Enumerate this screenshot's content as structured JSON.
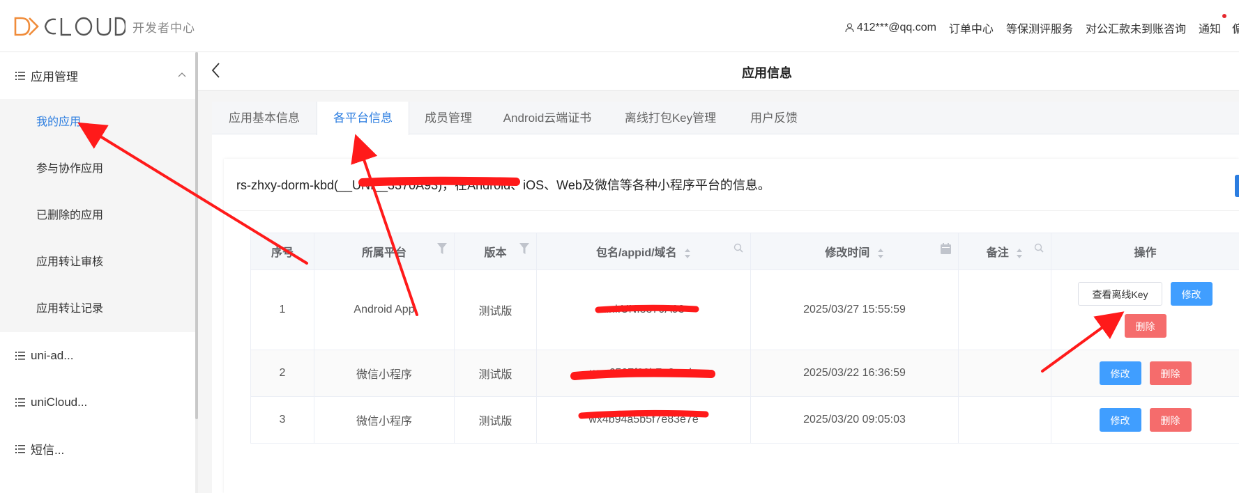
{
  "header": {
    "logo_text": "DCLOUD",
    "logo_sub": "开发者中心",
    "user": "412***@qq.com",
    "nav": [
      "订单中心",
      "等保测评服务",
      "对公汇款未到账咨询",
      "通知"
    ],
    "trunc": "偏"
  },
  "sidebar": {
    "group_app": "应用管理",
    "items": [
      "我的应用",
      "参与协作应用",
      "已删除的应用",
      "应用转让审核",
      "应用转让记录"
    ],
    "groups": [
      "uni-ad...",
      "uniCloud...",
      "短信..."
    ]
  },
  "page": {
    "title": "应用信息"
  },
  "tabs": [
    "应用基本信息",
    "各平台信息",
    "成员管理",
    "Android云端证书",
    "离线打包Key管理",
    "用户反馈"
  ],
  "description": "rs-zhxy-dorm-kbd(__UNI__3370A93)，在Android、iOS、Web及微信等各种小程序平台的信息。",
  "table": {
    "headers": [
      "序号",
      "所属平台",
      "版本",
      "包名/appid/域名",
      "修改时间",
      "备注",
      "操作"
    ],
    "rows": [
      {
        "index": "1",
        "platform": "Android App",
        "version": "测试版",
        "package": "uni.UNI3370A93",
        "time": "2025/03/27 15:55:59",
        "note": ""
      },
      {
        "index": "2",
        "platform": "微信小程序",
        "version": "测试版",
        "package": "wxc6507f20b7a8ccdc",
        "time": "2025/03/22 16:36:59",
        "note": ""
      },
      {
        "index": "3",
        "platform": "微信小程序",
        "version": "测试版",
        "package": "wx4b94a5b5f7e83e7e",
        "time": "2025/03/20 09:05:03",
        "note": ""
      }
    ],
    "buttons": {
      "view_key": "查看离线Key",
      "edit": "修改",
      "delete": "删除"
    }
  },
  "colors": {
    "accent": "#2b7de0",
    "primary_button": "#409eff",
    "danger_button": "#f56c6c",
    "annotation": "#ff1a1a"
  }
}
